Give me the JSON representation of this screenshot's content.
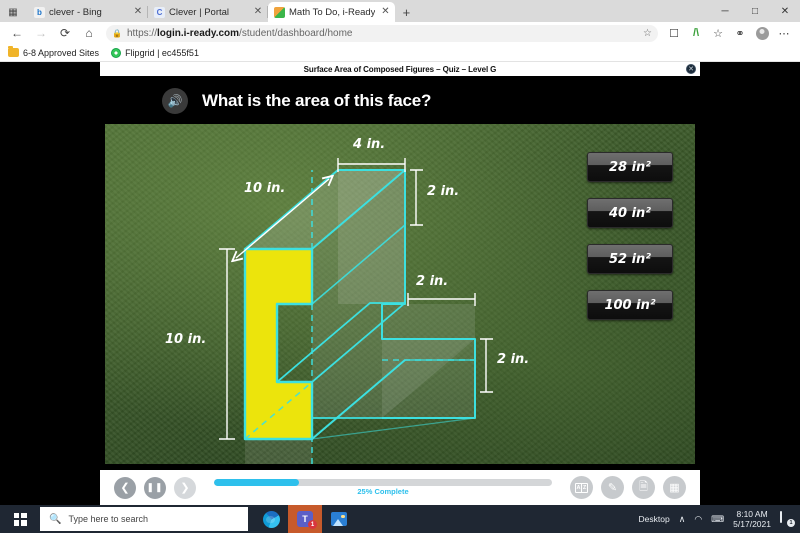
{
  "browser": {
    "tabs": [
      {
        "title": "clever - Bing",
        "favicon": "bing-icon",
        "active": false
      },
      {
        "title": "Clever | Portal",
        "favicon": "clever-icon",
        "active": false
      },
      {
        "title": "Math To Do, i-Ready",
        "favicon": "iready-cube-icon",
        "active": true
      }
    ],
    "new_tab_label": "+",
    "window_controls": {
      "minimize": "─",
      "maximize": "□",
      "close": "✕"
    },
    "nav": {
      "back": "←",
      "forward": "→",
      "refresh": "⟳",
      "home": "⌂"
    },
    "address": {
      "lock": "🔒",
      "url_prefix": "https://",
      "url_domain": "login.i-ready.com",
      "url_path": "/student/dashboard/home",
      "favorite": "☆"
    },
    "toolbar_icons": [
      "collections-icon",
      "math-solver-icon",
      "favorites-icon",
      "browser-essentials-icon",
      "profile-icon",
      "settings-more-icon"
    ],
    "bookmarks": [
      {
        "label": "6-8 Approved Sites",
        "icon": "folder-icon"
      },
      {
        "label": "Flipgrid | ec455f51",
        "icon": "flipgrid-icon"
      }
    ]
  },
  "quiz": {
    "title": "Surface Area of Composed Figures – Quiz – Level G",
    "close_label": "✕",
    "question": "What is the area of this face?",
    "speaker_icon": "speaker-icon",
    "answers": [
      {
        "label": "28 in²"
      },
      {
        "label": "40 in²"
      },
      {
        "label": "52 in²"
      },
      {
        "label": "100 in²"
      }
    ],
    "figure": {
      "description": "L-shaped rectangular composed prism with front C-shaped face highlighted in yellow",
      "labels": [
        {
          "text": "4 in.",
          "position": "top-width"
        },
        {
          "text": "10 in.",
          "position": "depth-diagonal"
        },
        {
          "text": "2 in.",
          "position": "upper-right-height"
        },
        {
          "text": "2 in.",
          "position": "lower-notch-width"
        },
        {
          "text": "2 in.",
          "position": "lower-right-height"
        },
        {
          "text": "10 in.",
          "position": "left-height"
        }
      ],
      "colors": {
        "highlight": "#ece40c",
        "edge": "#3ce0e0",
        "background": "#3c5a2a"
      }
    },
    "progress": {
      "percent": 25,
      "text": "25% Complete",
      "color": "#2ec0ec"
    },
    "controls": {
      "back": "❮",
      "pause": "❘❘",
      "forward": "❯"
    },
    "tools": [
      {
        "name": "glossary-tool",
        "label": "A|Z"
      },
      {
        "name": "annotate-tool",
        "label": "✎"
      },
      {
        "name": "notepad-tool",
        "label": "▤"
      },
      {
        "name": "calculator-tool",
        "label": "⌸"
      }
    ]
  },
  "taskbar": {
    "start_label": "Start",
    "search_placeholder": "Type here to search",
    "search_icon": "search-icon",
    "apps": [
      {
        "name": "edge-app",
        "label": "Microsoft Edge",
        "badge": ""
      },
      {
        "name": "teams-app",
        "label": "Microsoft Teams",
        "badge": "1"
      },
      {
        "name": "photos-app",
        "label": "Photos",
        "badge": ""
      }
    ],
    "tray": {
      "desktop_label": "Desktop",
      "overflow": "››",
      "chevron": "∧",
      "network_icon": "wifi-icon",
      "keyboard_icon": "keyboard-icon",
      "time": "8:10 AM",
      "date": "5/17/2021",
      "notification_badge": "1"
    }
  }
}
